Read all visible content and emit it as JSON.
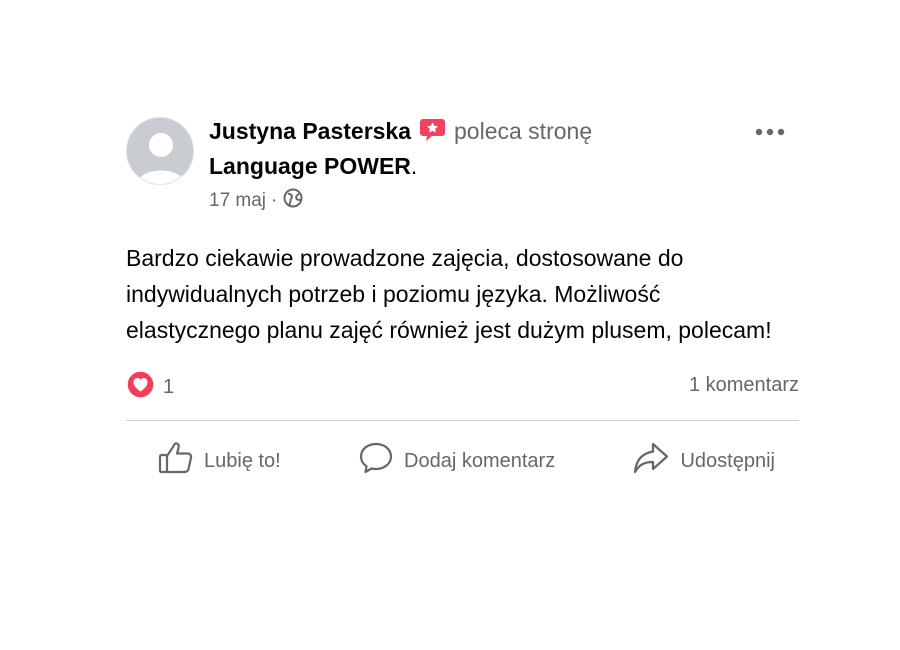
{
  "post": {
    "author": "Justyna Pasterska",
    "action_text": "poleca stronę",
    "page_name": "Language POWER",
    "period": ".",
    "date": "17 maj",
    "meta_separator": "·",
    "body": "Bardzo ciekawie prowadzone zajęcia, dostosowane do indywidualnych potrzeb i poziomu języka. Możliwość elastycznego planu zajęć również jest dużym plusem, polecam!",
    "reaction_count": "1",
    "comments_label": "1 komentarz"
  },
  "actions": {
    "like_label": "Lubię to!",
    "comment_label": "Dodaj komentarz",
    "share_label": "Udostępnij"
  },
  "colors": {
    "text_primary": "#050505",
    "text_secondary": "#65676b",
    "recommend_badge": "#f3425f",
    "love_reaction": "#f33e58",
    "divider": "#ced0d4",
    "avatar_bg": "#c9ccd1"
  },
  "icons": {
    "recommend": "recommend-badge-icon",
    "privacy": "globe-icon",
    "more": "more-options-icon",
    "reaction": "heart-reaction-icon",
    "like": "thumbs-up-icon",
    "comment": "comment-bubble-icon",
    "share": "share-arrow-icon"
  }
}
